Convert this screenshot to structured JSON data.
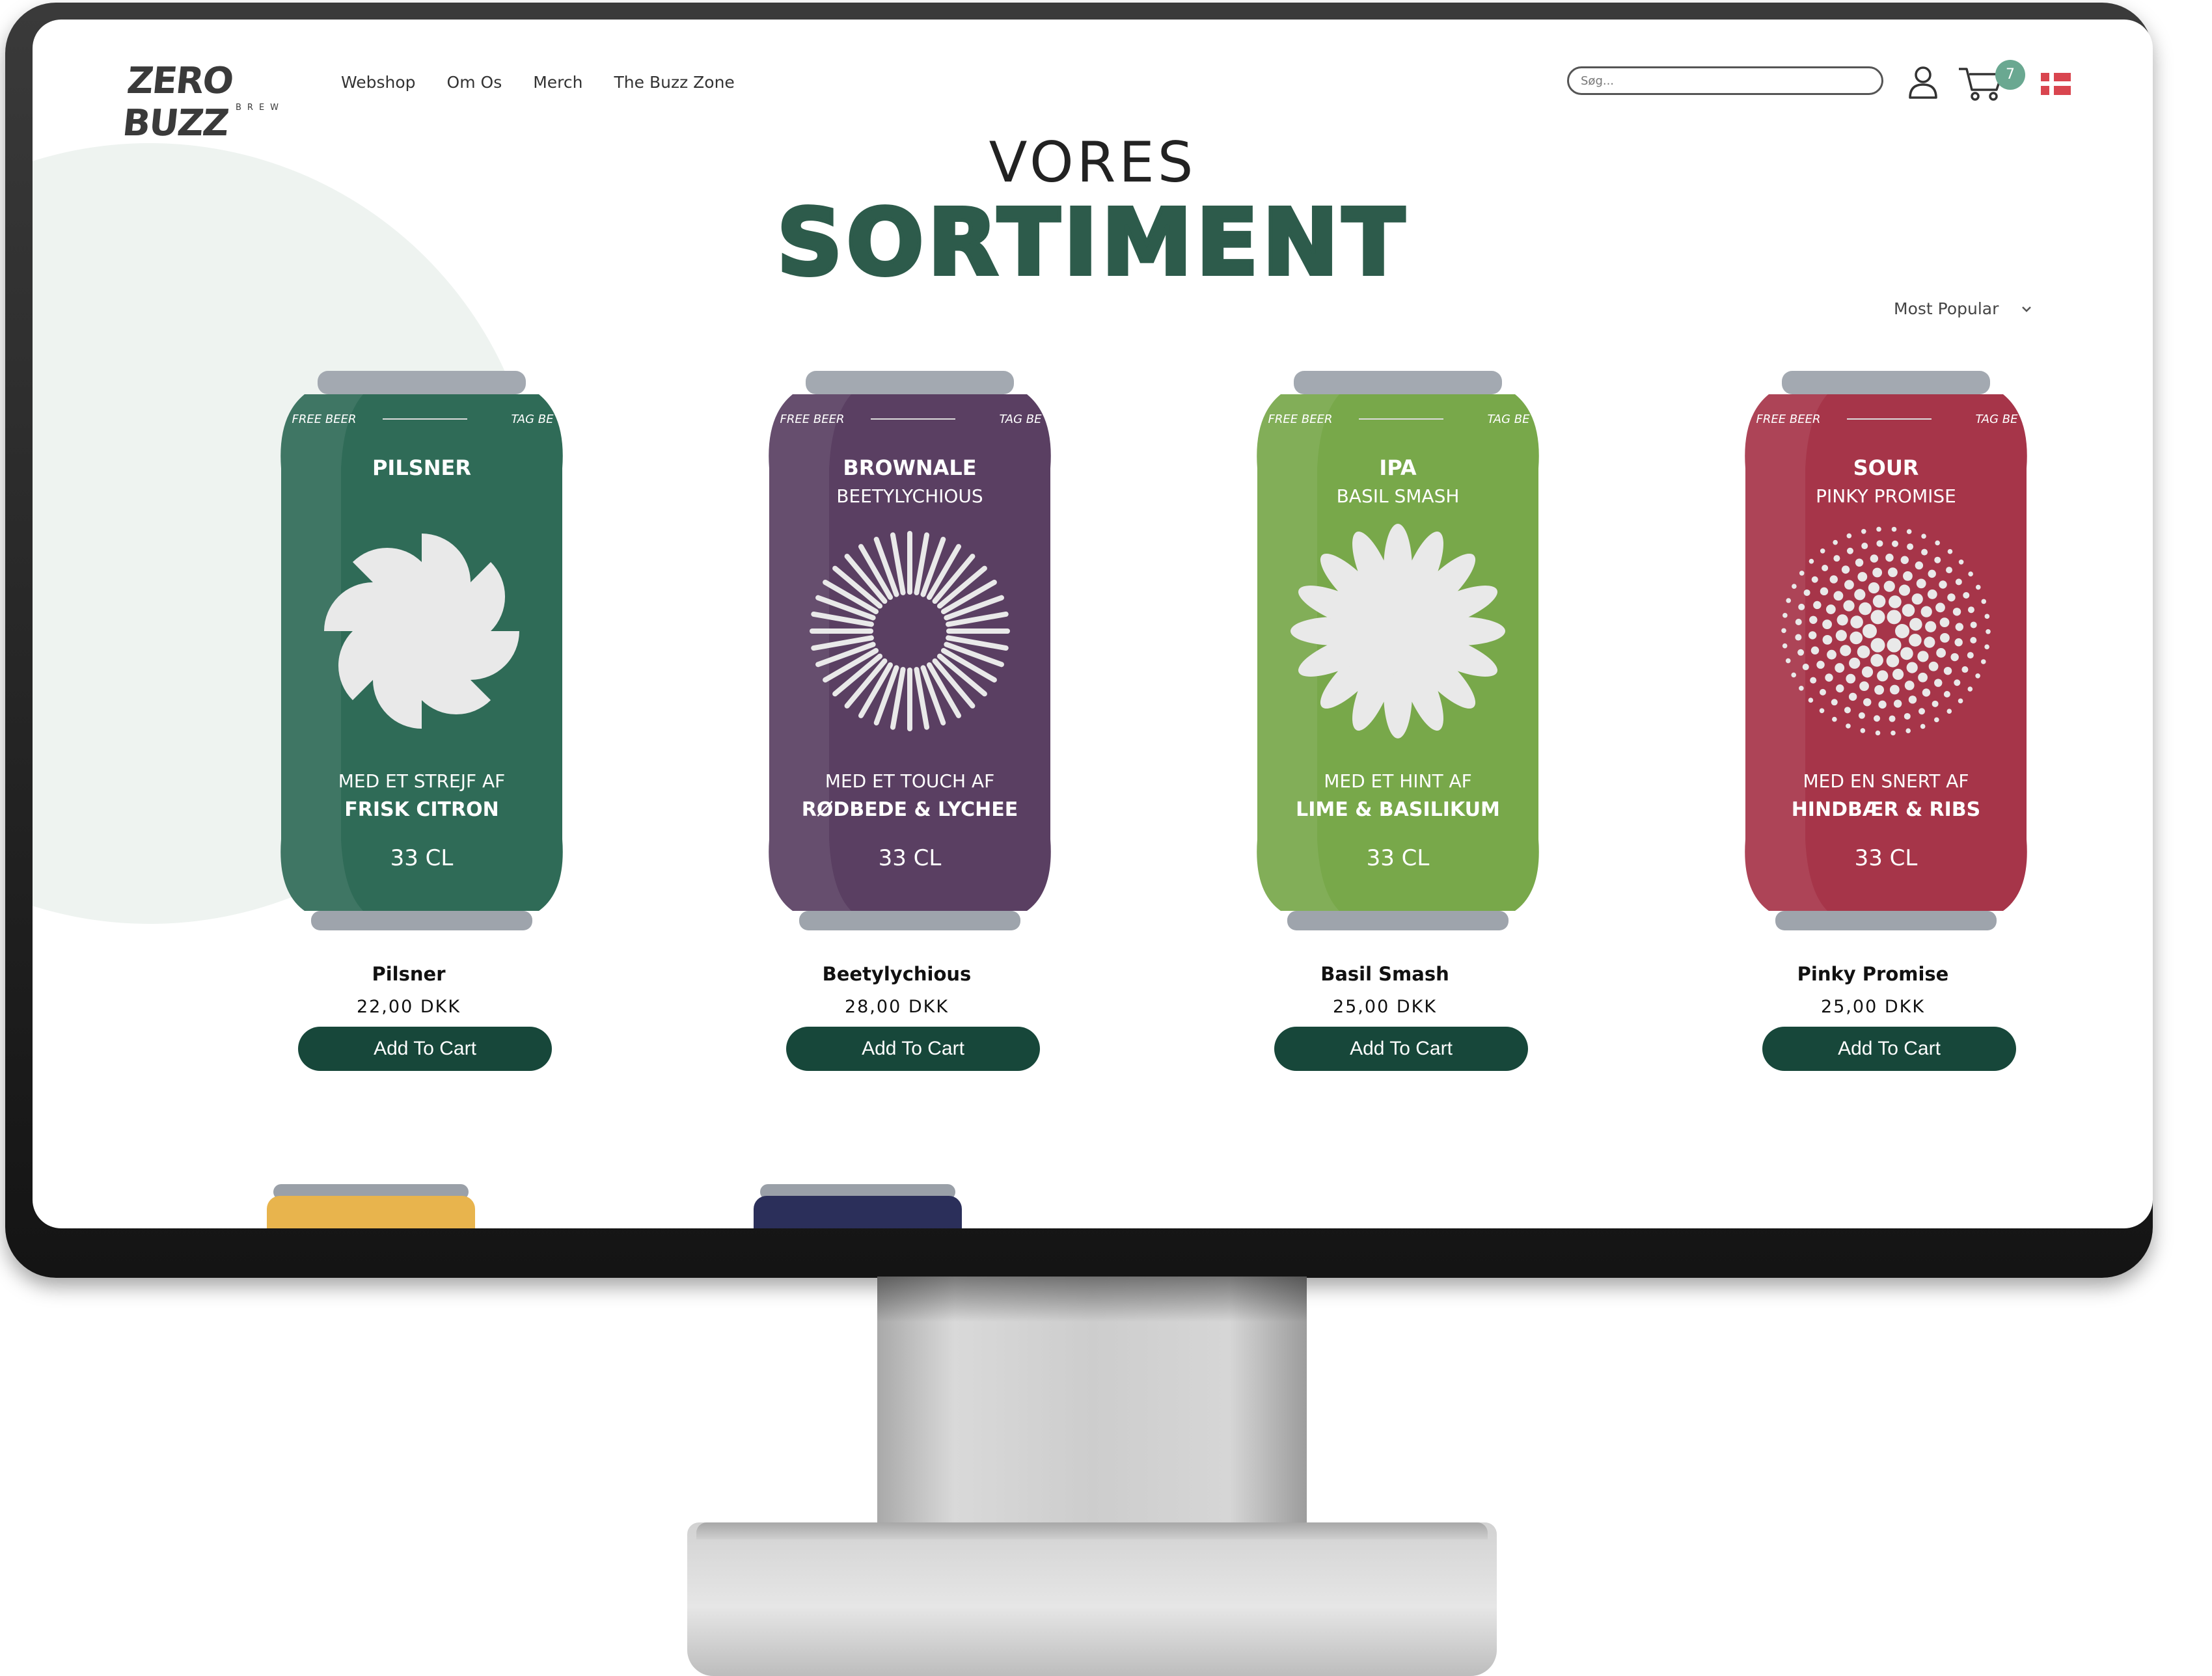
{
  "header": {
    "logo_text": "ZERO BUZZ",
    "logo_sub": "BREW",
    "nav": [
      "Webshop",
      "Om Os",
      "Merch",
      "The Buzz Zone"
    ],
    "search_placeholder": "Søg...",
    "cart_count": "7"
  },
  "hero": {
    "title_top": "VORES",
    "title_main": "SORTIMENT"
  },
  "sort": {
    "selected": "Most Popular"
  },
  "can_common": {
    "left_band": "FREE BEER",
    "right_band": "TAG BE"
  },
  "products": [
    {
      "name": "Pilsner",
      "price": "22,00 DKK",
      "button": "Add To Cart",
      "can": {
        "type": "PILSNER",
        "subtitle": "",
        "tag1": "MED ET STREJF AF",
        "tag2": "FRISK CITRON",
        "volume": "33 CL",
        "color": "#2f6b57",
        "icon": "pinwheel-icon"
      }
    },
    {
      "name": "Beetylychious",
      "price": "28,00 DKK",
      "button": "Add To Cart",
      "can": {
        "type": "BROWNALE",
        "subtitle": "BEETYLYCHIOUS",
        "tag1": "MED ET TOUCH AF",
        "tag2": "RØDBEDE & LYCHEE",
        "volume": "33 CL",
        "color": "#5a3f62",
        "icon": "sunburst-icon"
      }
    },
    {
      "name": "Basil Smash",
      "price": "25,00 DKK",
      "button": "Add To Cart",
      "can": {
        "type": "IPA",
        "subtitle": "BASIL SMASH",
        "tag1": "MED ET HINT AF",
        "tag2": "LIME & BASILIKUM",
        "volume": "33 CL",
        "color": "#78a84a",
        "icon": "flower-icon"
      }
    },
    {
      "name": "Pinky Promise",
      "price": "25,00 DKK",
      "button": "Add To Cart",
      "can": {
        "type": "SOUR",
        "subtitle": "PINKY PROMISE",
        "tag1": "MED EN SNERT AF",
        "tag2": "HINDBÆR & RIBS",
        "volume": "33 CL",
        "color": "#a63549",
        "icon": "dot-sphere-icon"
      }
    }
  ],
  "colors": {
    "brand_green": "#2d5b4b",
    "button_green": "#17473a",
    "badge": "#6aa891",
    "next_row_can_1": "#e8b44d",
    "next_row_can_2": "#2b2f5a"
  }
}
